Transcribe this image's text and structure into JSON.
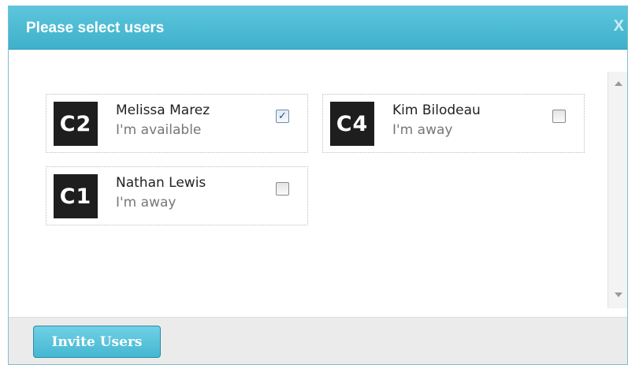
{
  "dialog": {
    "title": "Please select users",
    "close_label": "X"
  },
  "users": [
    {
      "initials": "C2",
      "name": "Melissa Marez",
      "status": "I'm available",
      "checked": true
    },
    {
      "initials": "C4",
      "name": "Kim Bilodeau",
      "status": "I'm away",
      "checked": false
    },
    {
      "initials": "C1",
      "name": "Nathan Lewis",
      "status": "I'm away",
      "checked": false
    }
  ],
  "footer": {
    "invite_label": "Invite Users"
  },
  "colors": {
    "title_bar": "#4dbcd5",
    "button": "#55c2da",
    "avatar_bg": "#1e1e1e"
  }
}
